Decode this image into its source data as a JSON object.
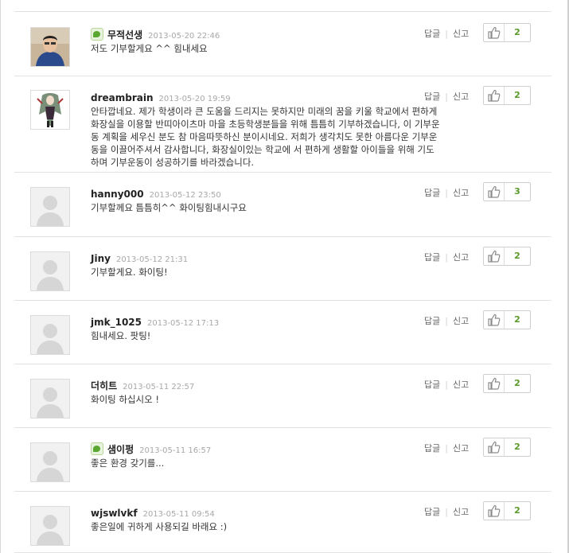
{
  "comments": [
    {
      "nickname": "무적선생",
      "verified": true,
      "date": "2013-05-20 22:46",
      "text": "저도 기부할게요 ^^ 힘내세요",
      "reply": "답글",
      "report": "신고",
      "likes": "2",
      "avatar": "photo"
    },
    {
      "nickname": "dreambrain",
      "verified": false,
      "date": "2013-05-20 19:59",
      "text": "안타깝네요. 제가 학생이라 큰 도움을 드리지는 못하지만 미래의 꿈을 키울 학교에서 편하게 화장실을 이용할 반띠아이츠마 마을 초등학생분들을 위해 틈틈히 기부하겠습니다, 이 기부운동 계획을 세우신 분도 참 마음따뜻하신 분이시네요. 저희가 생각치도 못한 아름다운 기부운동을 이끌어주셔서 감사합니다, 화장실이있는 학교에 서 편하게 생활할 아이들을 위해 기도하며 기부운동이 성공하기를 바라겠습니다.",
      "reply": "답글",
      "report": "신고",
      "likes": "2",
      "avatar": "character"
    },
    {
      "nickname": "hanny000",
      "verified": false,
      "date": "2013-05-12 23:50",
      "text": "기부할께요 틈틈히^^ 화이팅힘내시구요",
      "reply": "답글",
      "report": "신고",
      "likes": "3",
      "avatar": "default"
    },
    {
      "nickname": "Jiny",
      "verified": false,
      "date": "2013-05-12 21:31",
      "text": "기부할게요. 화이팅!",
      "reply": "답글",
      "report": "신고",
      "likes": "2",
      "avatar": "default"
    },
    {
      "nickname": "jmk_1025",
      "verified": false,
      "date": "2013-05-12 17:13",
      "text": "힘내세요. 팟팅!",
      "reply": "답글",
      "report": "신고",
      "likes": "2",
      "avatar": "default"
    },
    {
      "nickname": "더히트",
      "verified": false,
      "date": "2013-05-11 22:57",
      "text": "화이팅 하십시오 !",
      "reply": "답글",
      "report": "신고",
      "likes": "2",
      "avatar": "default"
    },
    {
      "nickname": "샘이펑",
      "verified": true,
      "date": "2013-05-11 16:57",
      "text": "좋은 환경 갖기를...",
      "reply": "답글",
      "report": "신고",
      "likes": "2",
      "avatar": "default"
    },
    {
      "nickname": "wjswlvkf",
      "verified": false,
      "date": "2013-05-11 09:54",
      "text": "좋은일에 귀하게 사용되길 바래요 :)",
      "reply": "답글",
      "report": "신고",
      "likes": "2",
      "avatar": "default"
    }
  ]
}
